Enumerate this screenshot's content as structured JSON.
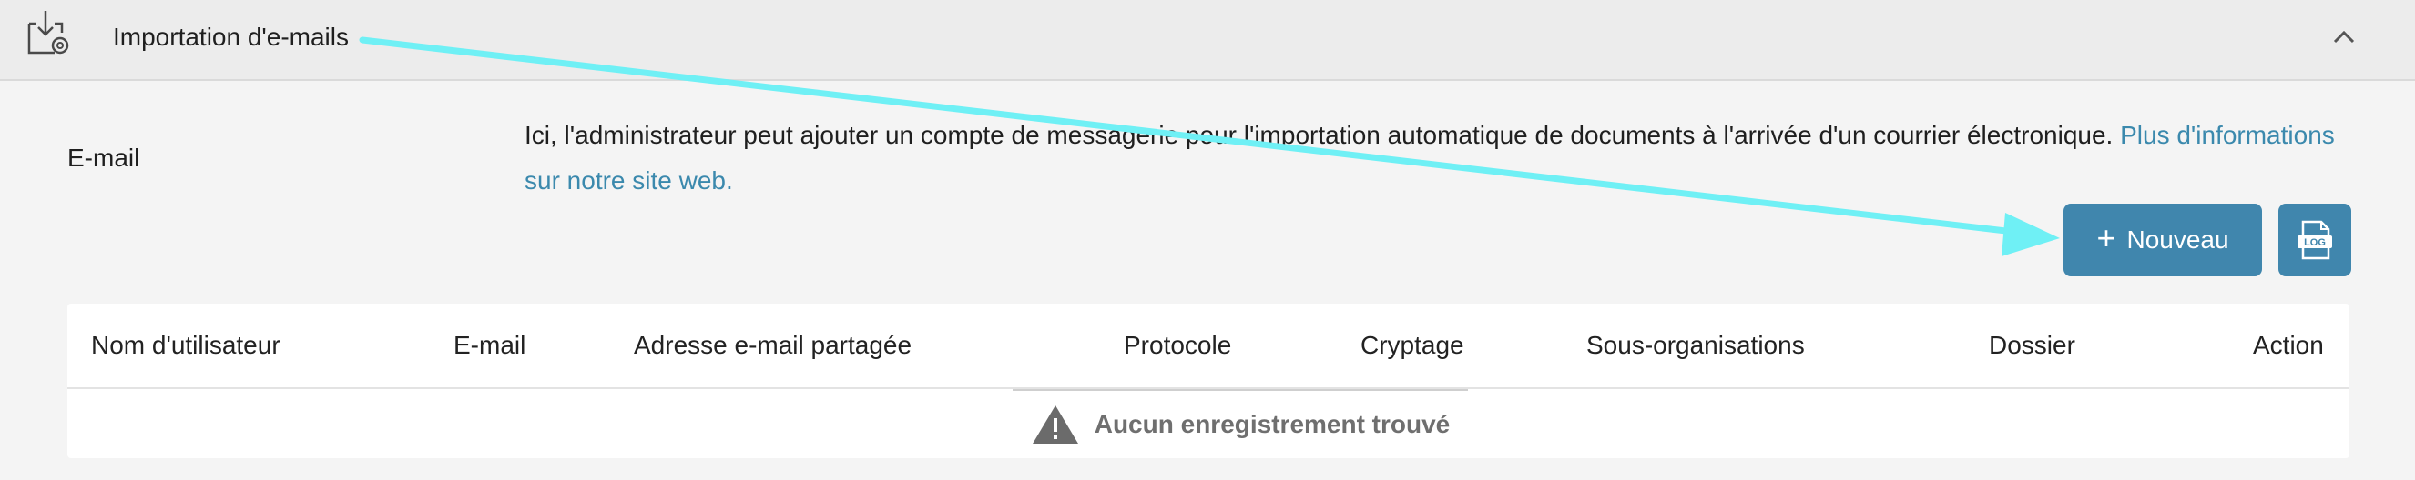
{
  "header": {
    "title": "Importation d'e-mails",
    "icon": "mail-import-icon",
    "collapse_icon": "chevron-up-icon"
  },
  "section": {
    "label": "E-mail",
    "description": "Ici, l'administrateur peut ajouter un compte de messagerie pour l'importation automatique de documents à l'arrivée d'un courrier électronique.",
    "link_text": "Plus d'informations sur notre site web."
  },
  "actions": {
    "new_label": "Nouveau",
    "new_icon": "plus-icon",
    "log_icon": "log-file-icon",
    "log_icon_text": "LOG"
  },
  "table": {
    "columns": [
      "Nom d'utilisateur",
      "E-mail",
      "Adresse e-mail partagée",
      "Protocole",
      "Cryptage",
      "Sous-organisations",
      "Dossier",
      "Action"
    ],
    "empty_message": "Aucun enregistrement trouvé",
    "empty_icon": "warning-icon"
  },
  "colors": {
    "accent": "#4086ad",
    "link": "#3b89ad",
    "annotation": "#6ff0f5"
  }
}
